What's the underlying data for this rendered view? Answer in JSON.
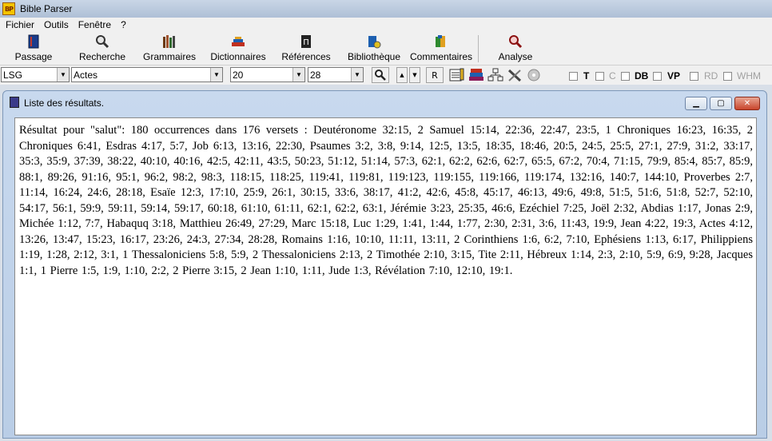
{
  "window": {
    "title": "Bible Parser",
    "icon_text": "BP"
  },
  "menu": [
    "Fichier",
    "Outils",
    "Fenêtre",
    "?"
  ],
  "toolbar": [
    {
      "label": "Passage",
      "icon": "passage-icon",
      "color": "#1b3c8c"
    },
    {
      "label": "Recherche",
      "icon": "search-icon",
      "color": "#333333"
    },
    {
      "label": "Grammaires",
      "icon": "grammar-icon",
      "color": "#6b3a10"
    },
    {
      "label": "Dictionnaires",
      "icon": "dictionary-icon",
      "color": "#c03020"
    },
    {
      "label": "Références",
      "icon": "references-icon",
      "color": "#222222"
    },
    {
      "label": "Bibliothèque",
      "icon": "library-icon",
      "color": "#1d5fb0"
    },
    {
      "label": "Commentaires",
      "icon": "comments-icon",
      "color": "#2f8a2f"
    },
    {
      "label": "Analyse",
      "icon": "analysis-icon",
      "color": "#8b1010"
    }
  ],
  "selectors": {
    "version": "LSG",
    "book": "Actes",
    "chapter": "20",
    "verse": "28",
    "r_label": "R"
  },
  "options": [
    {
      "label": "T",
      "enabled": true
    },
    {
      "label": "C",
      "enabled": false
    },
    {
      "label": "DB",
      "enabled": true
    },
    {
      "label": "VP",
      "enabled": true
    },
    {
      "label": "RD",
      "enabled": false
    },
    {
      "label": "WHM",
      "enabled": false
    }
  ],
  "results_window": {
    "title": "Liste des résultats.",
    "text": "Résultat pour \"salut\": 180 occurrences dans  176 versets : Deutéronome  32:15, 2 Samuel  15:14,  22:36,  22:47,  23:5, 1 Chroniques  16:23,  16:35, 2 Chroniques  6:41, Esdras  4:17,  5:7, Job  6:13,  13:16,  22:30, Psaumes  3:2,  3:8,  9:14,  12:5,  13:5,  18:35,  18:46,  20:5,  24:5,  25:5,  27:1,  27:9,  31:2,  33:17,  35:3,  35:9,  37:39,  38:22,  40:10,  40:16,  42:5,  42:11,  43:5,  50:23,  51:12,  51:14,  57:3,  62:1,  62:2,  62:6,  62:7,  65:5,  67:2,  70:4,  71:15,  79:9,  85:4,  85:7,  85:9,  88:1,  89:26,  91:16,  95:1,  96:2,  98:2,  98:3,  118:15,  118:25,  119:41,  119:81,  119:123,  119:155,  119:166,  119:174,  132:16,  140:7,  144:10, Proverbes  2:7,  11:14,  16:24,  24:6,  28:18, Esaïe  12:3,  17:10,  25:9,  26:1,  30:15,  33:6,  38:17,  41:2,  42:6,  45:8,  45:17,  46:13,  49:6,  49:8,  51:5,  51:6,  51:8,  52:7,  52:10,  54:17,  56:1,  59:9,  59:11,  59:14,  59:17,  60:18,  61:10,  61:11,  62:1,  62:2,  63:1, Jérémie  3:23,  25:35,  46:6, Ezéchiel  7:25, Joël  2:32, Abdias  1:17, Jonas  2:9, Michée  1:12,  7:7, Habaquq  3:18, Matthieu  26:49,  27:29, Marc  15:18, Luc  1:29,  1:41,  1:44,  1:77,  2:30,  2:31,  3:6,  11:43,  19:9, Jean  4:22,  19:3, Actes  4:12,  13:26,  13:47,  15:23,  16:17,  23:26,  24:3,  27:34,  28:28, Romains  1:16,  10:10,  11:11,  13:11, 2 Corinthiens  1:6,  6:2,  7:10, Ephésiens  1:13,  6:17, Philippiens  1:19,  1:28,  2:12,  3:1, 1 Thessaloniciens  5:8,  5:9, 2 Thessaloniciens  2:13, 2 Timothée  2:10,  3:15, Tite  2:11, Hébreux  1:14,  2:3,  2:10,  5:9,  6:9,  9:28, Jacques  1:1, 1 Pierre  1:5,  1:9,  1:10,  2:2, 2 Pierre  3:15, 2 Jean  1:10,  1:11, Jude  1:3, Révélation  7:10,  12:10,  19:1."
  }
}
